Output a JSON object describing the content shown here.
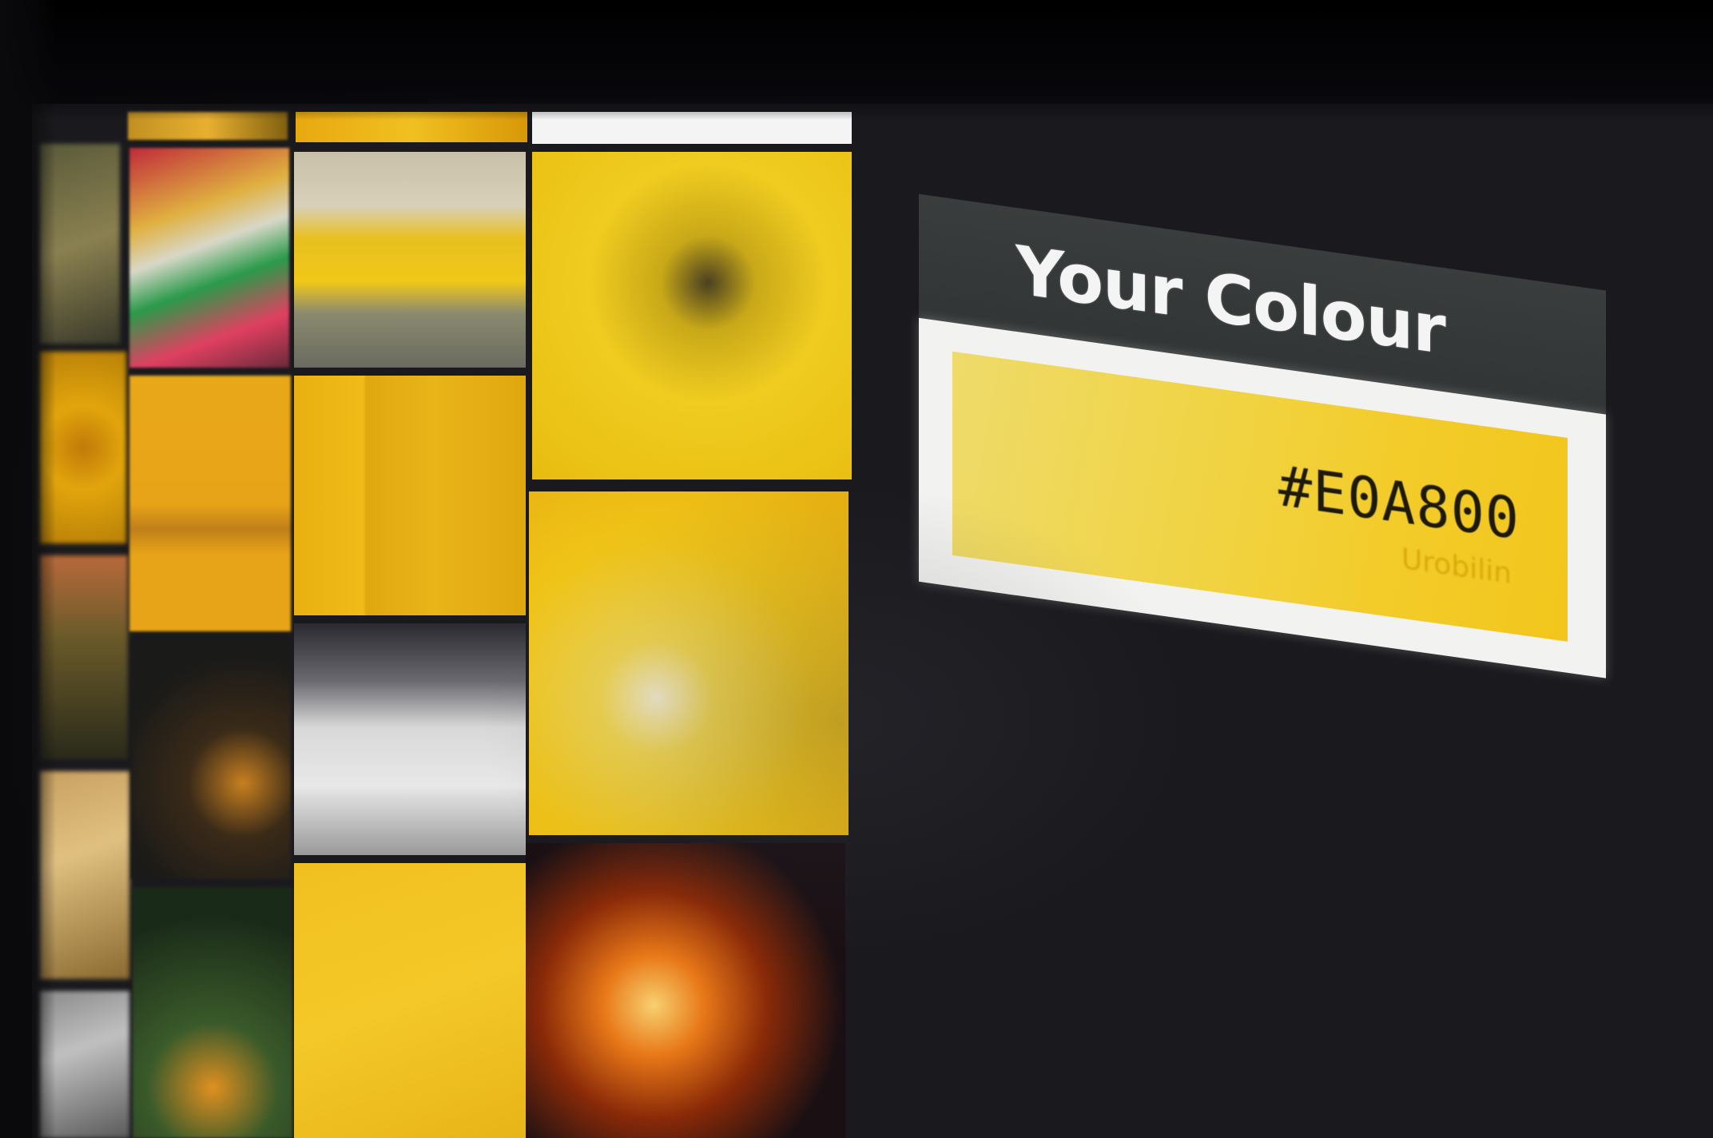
{
  "panel": {
    "title": "Your Colour",
    "hex": "#E0A800",
    "colour_name": "Urobilin"
  },
  "colors": {
    "accent": "#E0A800",
    "panel_header": "#363939",
    "panel_body": "#F2F2F0",
    "background": "#1A1A1E"
  },
  "tiles": [
    {
      "name": "thumb-bee-photo"
    },
    {
      "name": "thumb-colorful-boats"
    },
    {
      "name": "thumb-yellow-car"
    },
    {
      "name": "thumb-uncle-sam-figure"
    },
    {
      "name": "thumb-yellow-flower"
    },
    {
      "name": "thumb-yellow-building"
    },
    {
      "name": "thumb-yellow-wall"
    },
    {
      "name": "thumb-water-drops"
    },
    {
      "name": "thumb-firefighters"
    },
    {
      "name": "thumb-dark-street"
    },
    {
      "name": "thumb-white-letters"
    },
    {
      "name": "thumb-fire-at-night"
    },
    {
      "name": "thumb-yellow-food"
    },
    {
      "name": "thumb-green-plants"
    },
    {
      "name": "thumb-plain-yellow"
    },
    {
      "name": "thumb-orange-slices"
    }
  ]
}
